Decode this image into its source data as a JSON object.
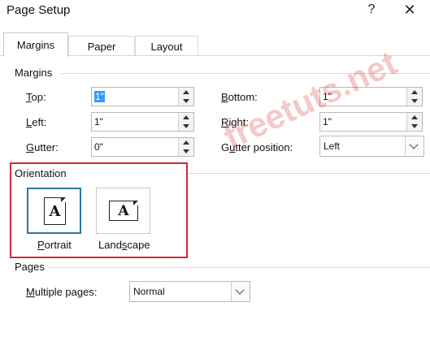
{
  "window": {
    "title": "Page Setup",
    "help_glyph": "?",
    "close_glyph": "✕"
  },
  "tabs": [
    {
      "label": "Margins",
      "active": true
    },
    {
      "label": "Paper",
      "active": false
    },
    {
      "label": "Layout",
      "active": false
    }
  ],
  "margins": {
    "heading": "Margins",
    "top": {
      "label_u": "T",
      "label_rest": "op:",
      "value": "1\""
    },
    "left": {
      "label_u": "L",
      "label_rest": "eft:",
      "value": "1\""
    },
    "gutter": {
      "label_u": "G",
      "label_rest": "utter:",
      "value": "0\""
    },
    "bottom": {
      "label_u": "B",
      "label_rest": "ottom:",
      "value": "1\""
    },
    "right": {
      "label_u": "R",
      "label_rest": "ight:",
      "value": "1\""
    },
    "gutter_position": {
      "label_pre": "G",
      "label_u": "u",
      "label_rest": "tter position:",
      "value": "Left"
    }
  },
  "orientation": {
    "heading": "Orientation",
    "portrait": {
      "label_u": "P",
      "label_rest": "ortrait",
      "glyph": "A",
      "selected": true
    },
    "landscape": {
      "label_pre": "Land",
      "label_u": "s",
      "label_rest": "cape",
      "glyph": "A",
      "selected": false
    }
  },
  "pages": {
    "heading": "Pages",
    "multiple_pages": {
      "label_u": "M",
      "label_rest": "ultiple pages:",
      "value": "Normal"
    }
  },
  "watermark": {
    "text": "freetuts.net"
  },
  "colors": {
    "selection": "#3399ff",
    "highlight_box": "#d0283a",
    "selected_border": "#2b7a9e"
  }
}
